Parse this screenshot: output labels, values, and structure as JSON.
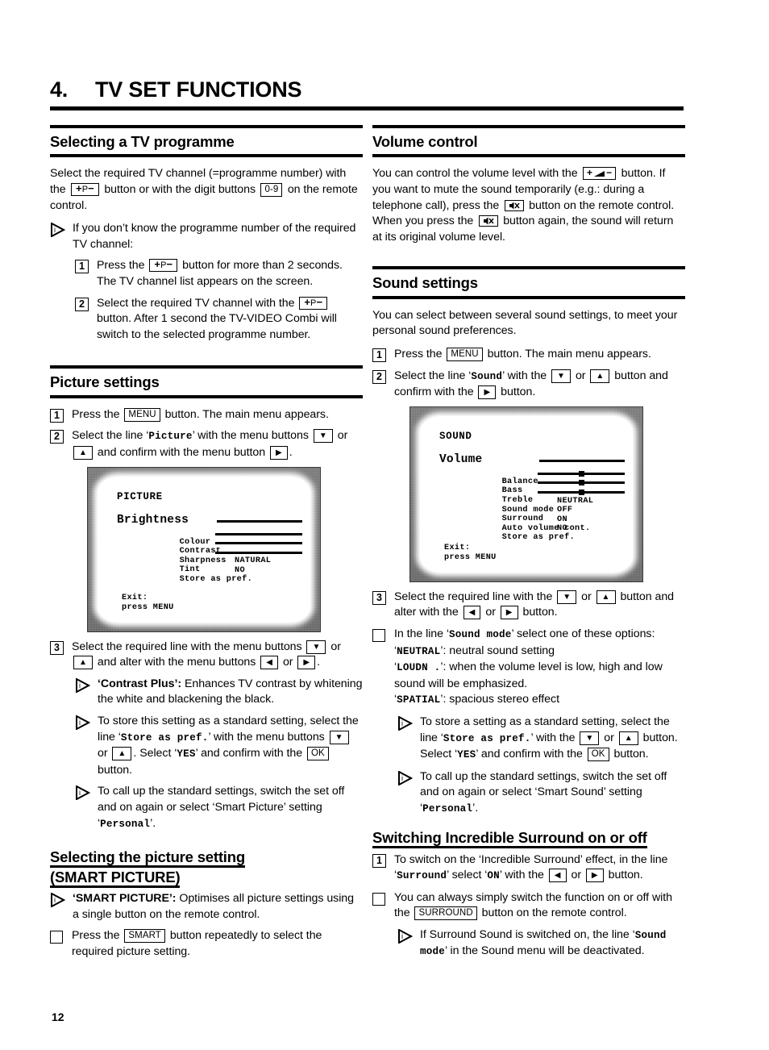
{
  "chapter": {
    "number": "4.",
    "title": "TV SET FUNCTIONS"
  },
  "page_number": "12",
  "icons": {
    "info_triangle": "info-triangle-icon",
    "program_button": "p-plus-minus-button-icon",
    "volume_button": "volume-plus-minus-button-icon",
    "mute_button": "mute-speaker-icon",
    "arrow_down": "arrow-down-icon",
    "arrow_up": "arrow-up-icon",
    "arrow_left": "arrow-left-icon",
    "arrow_right": "arrow-right-icon"
  },
  "keys": {
    "digits": "0-9",
    "menu": "MENU",
    "ok": "OK",
    "smart": "SMART",
    "surround": "SURROUND",
    "p_plus": "+",
    "p_letter": "P",
    "p_minus": "−",
    "vol_plus": "+",
    "vol_minus": "−"
  },
  "left_column": {
    "section1": {
      "heading": "Selecting a TV programme",
      "intro_a": "Select the required TV channel (=programme number) with the",
      "intro_b": "button or with the digit buttons",
      "intro_c": "on the remote control.",
      "note1": "If you don’t know the programme number of the required TV channel:",
      "step1_num": "1",
      "step1_a": "Press the",
      "step1_b": "button for more than 2 seconds. The TV channel list appears on the screen.",
      "step2_num": "2",
      "step2_a": "Select the required TV channel with the",
      "step2_b": "button.",
      "step2_c": "After 1 second the TV-VIDEO Combi will switch to the selected programme number."
    },
    "section2": {
      "heading": "Picture settings",
      "step1_num": "1",
      "step1_a": "Press the",
      "step1_b": "button. The main menu appears.",
      "step2_num": "2",
      "step2_a": "Select the line ‘",
      "step2_literal": "Picture",
      "step2_b": "’ with the menu buttons",
      "step2_c": "or",
      "step2_d": "and confirm with the menu button",
      "step2_e": ".",
      "tv": {
        "title": "PICTURE",
        "rows": [
          {
            "label": "Brightness",
            "type": "bar",
            "knob": false,
            "emphasis": "large"
          },
          {
            "label": "Colour",
            "type": "bar",
            "knob": false,
            "emphasis": "normal"
          },
          {
            "label": "Contrast",
            "type": "bar",
            "knob": false,
            "emphasis": "normal"
          },
          {
            "label": "Sharpness",
            "type": "bar",
            "knob": false,
            "emphasis": "normal"
          },
          {
            "label": "Tint",
            "type": "value",
            "value": "NATURAL",
            "emphasis": "normal"
          },
          {
            "label": "Store as pref.",
            "type": "value",
            "value": "NO",
            "emphasis": "normal"
          }
        ],
        "exit_line1": "Exit:",
        "exit_line2": "press MENU"
      },
      "step3_num": "3",
      "step3_a": "Select the required line with the menu buttons",
      "step3_b": "or",
      "step3_c": "and alter with the menu buttons",
      "step3_d": "or",
      "step3_e": ".",
      "note_contrast_label": "‘Contrast Plus’:",
      "note_contrast_text": " Enhances TV contrast by whitening the white and blackening the black.",
      "note_store_a": "To store this setting as a standard setting, select the line ‘",
      "note_store_literal": "Store as pref.",
      "note_store_b": "’ with the menu buttons",
      "note_store_c": "or",
      "note_store_d": ". Select ‘",
      "note_store_yes": "YES",
      "note_store_e": "’ and confirm with the",
      "note_store_f": "button.",
      "note_recall_a": "To call up the standard settings, switch the set off and on again or select ‘Smart Picture’ setting ‘",
      "note_recall_literal": "Personal",
      "note_recall_b": "’."
    },
    "section3": {
      "heading_line1": "Selecting the picture setting",
      "heading_line2": "(SMART PICTURE)",
      "note_label": "‘SMART PICTURE’:",
      "note_text": " Optimises all picture settings using a single button on the remote control.",
      "bullet_a": "Press the",
      "bullet_b": "button repeatedly to select the required picture setting."
    }
  },
  "right_column": {
    "section1": {
      "heading": "Volume control",
      "text_a": "You can control the volume level with the",
      "text_b": "button. If you want to mute the sound temporarily (e.g.: during a telephone call), press the",
      "text_c": "button on the remote control. When you press the",
      "text_d": "button again, the sound will return at its original volume level."
    },
    "section2": {
      "heading": "Sound settings",
      "intro": "You can select between several sound settings, to meet your personal sound preferences.",
      "step1_num": "1",
      "step1_a": "Press the",
      "step1_b": "button. The main menu appears.",
      "step2_num": "2",
      "step2_a": "Select the line ‘",
      "step2_literal": "Sound",
      "step2_b": "’ with the",
      "step2_c": "or",
      "step2_d": "button and confirm with the",
      "step2_e": "button.",
      "tv": {
        "title": "SOUND",
        "rows": [
          {
            "label": "Volume",
            "type": "bar",
            "knob": false,
            "emphasis": "large"
          },
          {
            "label": "Balance",
            "type": "bar",
            "knob": true,
            "emphasis": "normal"
          },
          {
            "label": "Bass",
            "type": "bar",
            "knob": true,
            "emphasis": "normal"
          },
          {
            "label": "Treble",
            "type": "bar",
            "knob": true,
            "emphasis": "normal"
          },
          {
            "label": "Sound mode",
            "type": "value",
            "value": "NEUTRAL",
            "emphasis": "normal"
          },
          {
            "label": "Surround",
            "type": "value",
            "value": "OFF",
            "emphasis": "bold"
          },
          {
            "label": "Auto volume cont.",
            "type": "value",
            "value": "ON",
            "emphasis": "normal"
          },
          {
            "label": "Store as pref.",
            "type": "value",
            "value": "NO",
            "emphasis": "normal"
          }
        ],
        "exit_line1": "Exit:",
        "exit_line2": "press MENU"
      },
      "step3_num": "3",
      "step3_a": "Select the required line with the",
      "step3_b": "or",
      "step3_c": "button and alter with the",
      "step3_d": "or",
      "step3_e": "button.",
      "bullet_a": "In the line ‘",
      "bullet_literal": "Sound mode",
      "bullet_b": "’ select one of these options:",
      "opt1_literal": "NEUTRAL",
      "opt1_text": "’: neutral sound setting",
      "opt2_literal": "LOUDN .",
      "opt2_text": "’: when the volume level is low, high and low sound will be emphasized.",
      "opt3_literal": "SPATIAL",
      "opt3_text": "’: spacious stereo effect",
      "note_store_a": "To store a setting as a standard setting, select the line ‘",
      "note_store_literal": "Store as pref.",
      "note_store_b": "’ with the",
      "note_store_c": "or",
      "note_store_d": "button. Select ‘",
      "note_store_yes": "YES",
      "note_store_e": "’ and confirm with the",
      "note_store_f": "button.",
      "note_recall_a": "To call up the standard settings, switch the set off and on again or select ‘Smart Sound’ setting ‘",
      "note_recall_literal": "Personal",
      "note_recall_b": "’."
    },
    "section3": {
      "heading": "Switching Incredible Surround on or off",
      "step1_num": "1",
      "step1_a": "To switch on the ‘Incredible Surround’ effect, in the line ‘",
      "step1_literal": "Surround",
      "step1_b": "’ select ‘",
      "step1_on": "ON",
      "step1_c": "’ with the",
      "step1_d": "or",
      "step1_e": "button.",
      "bullet_a": "You can always simply switch the function on or off with the",
      "bullet_b": "button on the remote control.",
      "note_a": "If Surround Sound is switched on, the line ‘",
      "note_literal1": "Sound",
      "note_literal2": "mode",
      "note_b": "’ in the Sound menu will be deactivated."
    }
  }
}
